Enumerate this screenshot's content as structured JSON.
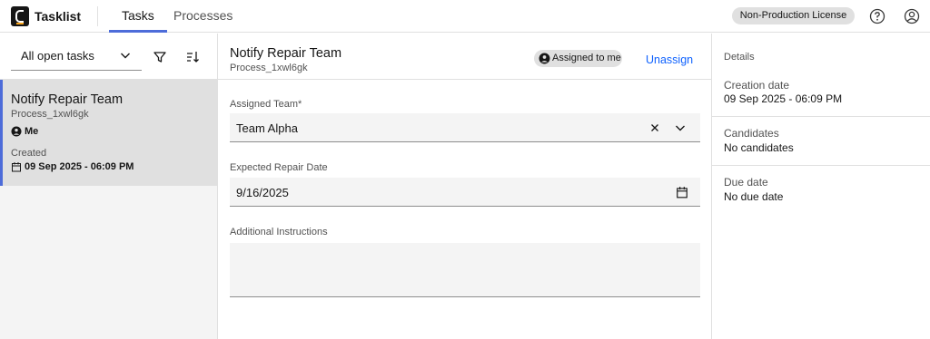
{
  "app": {
    "name": "Tasklist"
  },
  "nav": {
    "tabs": [
      {
        "label": "Tasks",
        "active": true
      },
      {
        "label": "Processes",
        "active": false
      }
    ]
  },
  "header": {
    "license_badge": "Non-Production License"
  },
  "filters": {
    "selected": "All open tasks"
  },
  "task_list": [
    {
      "title": "Notify Repair Team",
      "process": "Process_1xwl6gk",
      "assignee": "Me",
      "created_label": "Created",
      "created_date": "09 Sep 2025 - 06:09 PM"
    }
  ],
  "task": {
    "title": "Notify Repair Team",
    "process": "Process_1xwl6gk",
    "assigned_tag": "Assigned to me",
    "unassign_label": "Unassign"
  },
  "form": {
    "team": {
      "label": "Assigned Team*",
      "value": "Team Alpha"
    },
    "repair_date": {
      "label": "Expected Repair Date",
      "value": "9/16/2025"
    },
    "instructions": {
      "label": "Additional Instructions",
      "value": ""
    }
  },
  "details": {
    "heading": "Details",
    "creation": {
      "label": "Creation date",
      "value": "09 Sep 2025 - 06:09 PM"
    },
    "candidates": {
      "label": "Candidates",
      "value": "No candidates"
    },
    "due": {
      "label": "Due date",
      "value": "No due date"
    }
  },
  "colors": {
    "accent": "#4d6cd9",
    "link": "#0f62fe",
    "tag_bg": "#e0e0e0",
    "field_bg": "#f4f4f4"
  }
}
